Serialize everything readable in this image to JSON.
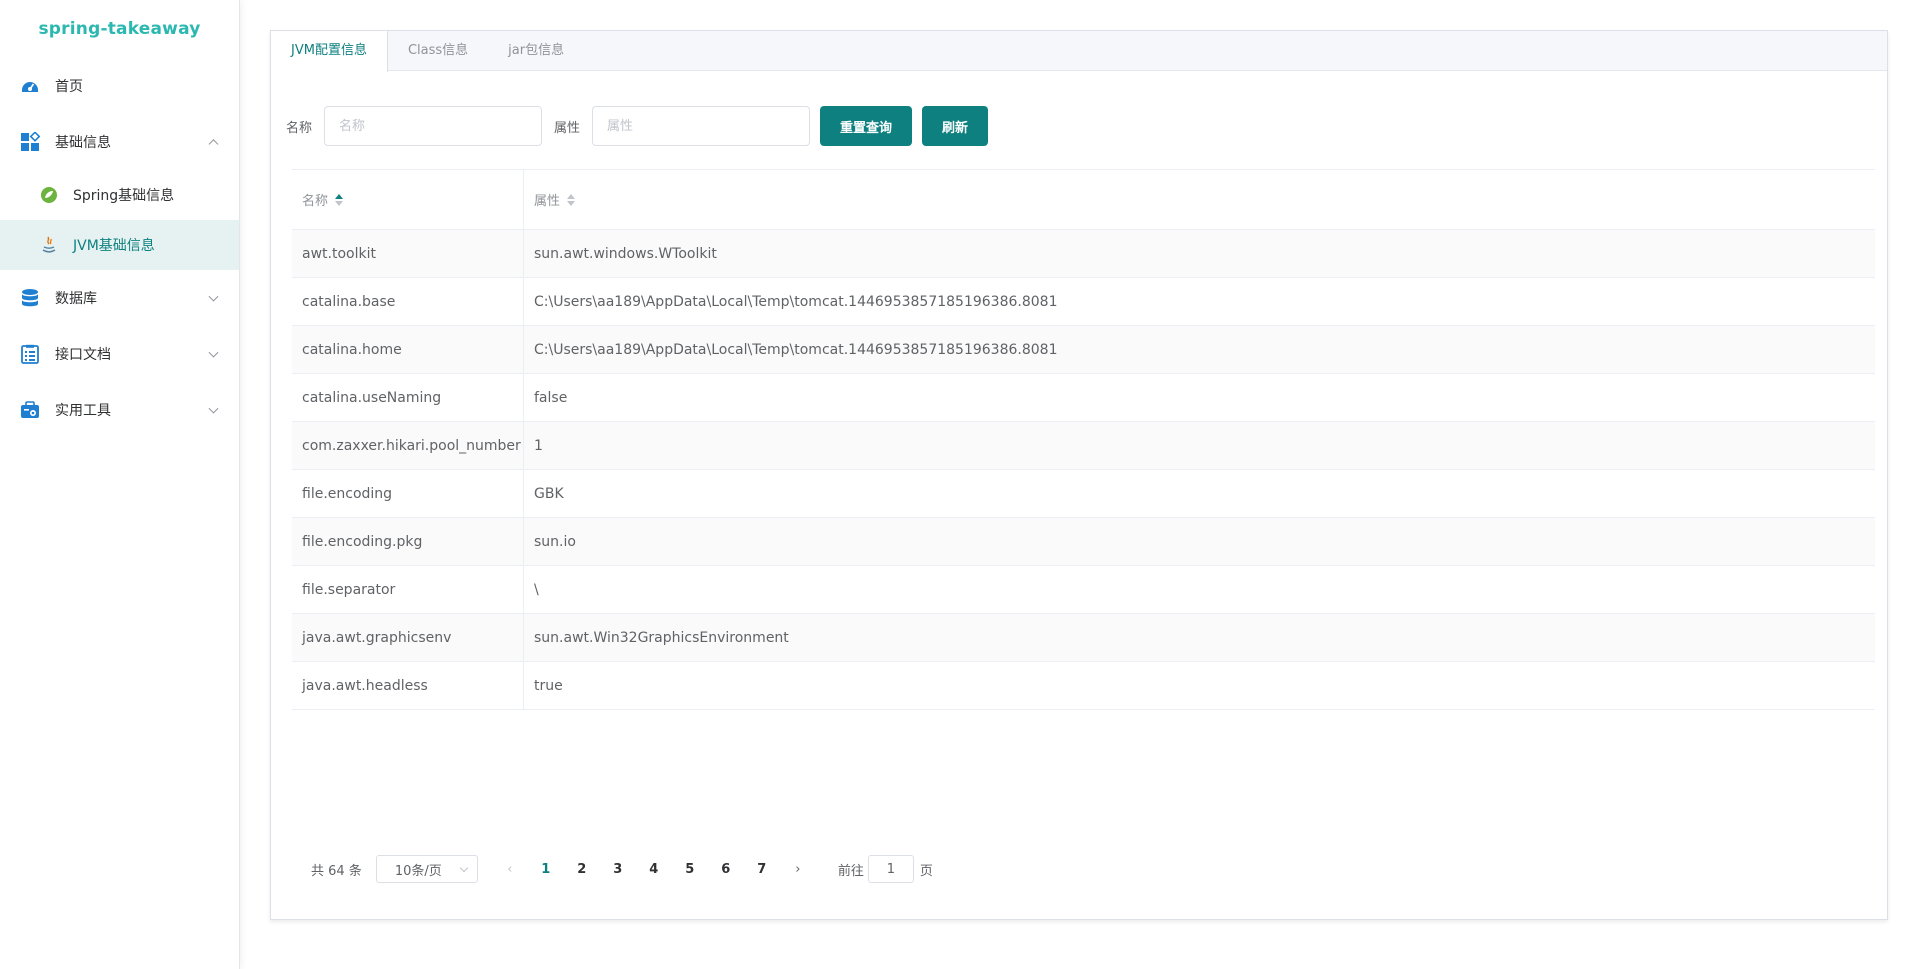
{
  "app": {
    "brand": "spring-takeaway"
  },
  "sidebar": {
    "items": [
      {
        "label": "首页",
        "icon": "dashboard-icon"
      },
      {
        "label": "基础信息",
        "icon": "grid-icon",
        "expanded": true,
        "children": [
          {
            "label": "Spring基础信息",
            "icon": "spring-icon"
          },
          {
            "label": "JVM基础信息",
            "icon": "java-icon",
            "active": true
          }
        ]
      },
      {
        "label": "数据库",
        "icon": "database-icon"
      },
      {
        "label": "接口文档",
        "icon": "document-icon"
      },
      {
        "label": "实用工具",
        "icon": "toolbox-icon"
      }
    ]
  },
  "tabs": [
    {
      "label": "JVM配置信息",
      "active": true
    },
    {
      "label": "Class信息"
    },
    {
      "label": "jar包信息"
    }
  ],
  "query": {
    "name_label": "名称",
    "name_placeholder": "名称",
    "attr_label": "属性",
    "attr_placeholder": "属性",
    "reset_button": "重置查询",
    "refresh_button": "刷新"
  },
  "table": {
    "headers": [
      "名称",
      "属性"
    ],
    "rows": [
      [
        "awt.toolkit",
        "sun.awt.windows.WToolkit"
      ],
      [
        "catalina.base",
        "C:\\Users\\aa189\\AppData\\Local\\Temp\\tomcat.1446953857185196386.8081"
      ],
      [
        "catalina.home",
        "C:\\Users\\aa189\\AppData\\Local\\Temp\\tomcat.1446953857185196386.8081"
      ],
      [
        "catalina.useNaming",
        "false"
      ],
      [
        "com.zaxxer.hikari.pool_number",
        "1"
      ],
      [
        "file.encoding",
        "GBK"
      ],
      [
        "file.encoding.pkg",
        "sun.io"
      ],
      [
        "file.separator",
        "\\"
      ],
      [
        "java.awt.graphicsenv",
        "sun.awt.Win32GraphicsEnvironment"
      ],
      [
        "java.awt.headless",
        "true"
      ]
    ]
  },
  "pagination": {
    "total": "共 64 条",
    "page_size": "10条/页",
    "pages": [
      "1",
      "2",
      "3",
      "4",
      "5",
      "6",
      "7"
    ],
    "current": "1",
    "goto_label": "前往",
    "goto_value": "1",
    "page_suffix": "页"
  },
  "colors": {
    "accent": "#0f8080",
    "brand": "#2bb8b0"
  }
}
